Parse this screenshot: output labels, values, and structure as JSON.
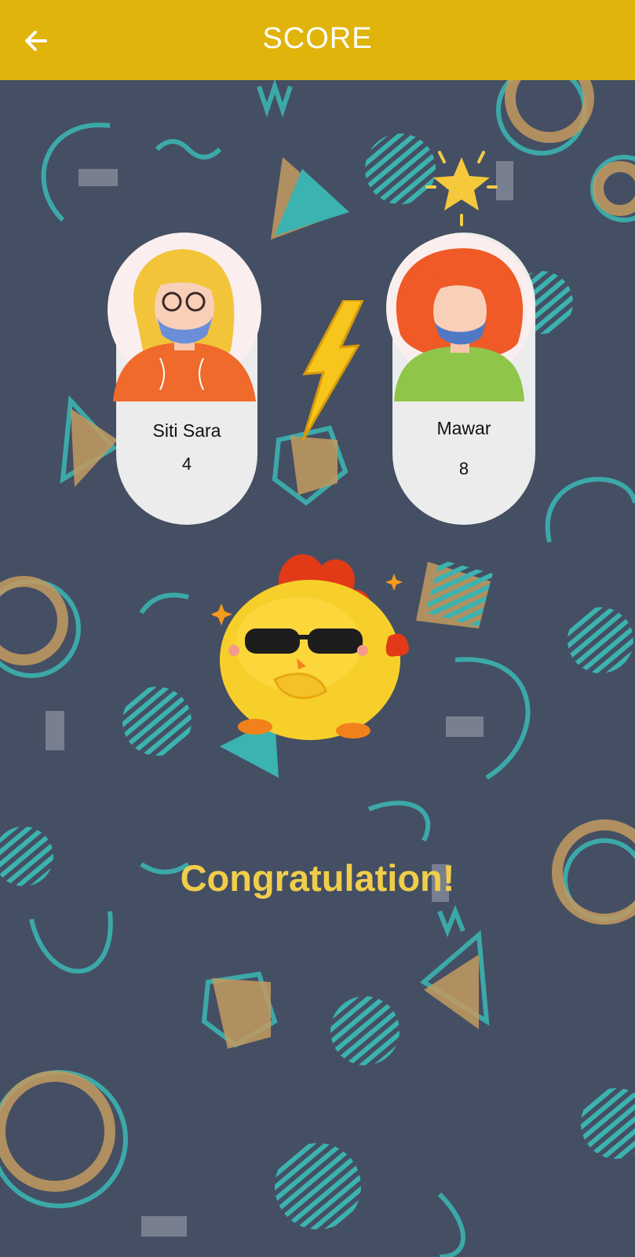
{
  "appbar": {
    "title": "SCORE",
    "back_icon": "arrow-left-icon",
    "color": "#e0b40a"
  },
  "players": [
    {
      "name": "Siti Sara",
      "score": "4"
    },
    {
      "name": "Mawar",
      "score": "8"
    }
  ],
  "result": {
    "message": "Congratulation!",
    "winner_marker": "star-icon",
    "versus_marker": "lightning-bolt-icon"
  },
  "colors": {
    "background": "#454f63",
    "accent_teal": "#3bb3b0",
    "accent_tan": "#c39a5f",
    "message": "#f0cd4a"
  }
}
